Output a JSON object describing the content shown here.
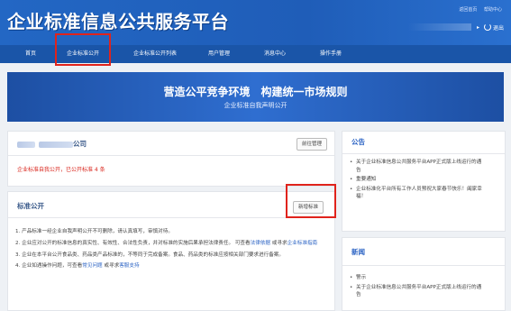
{
  "app": {
    "logo_text": "企业标准信息公共服务平台"
  },
  "top_links": {
    "back_home": "返回首页",
    "help_center": "帮助中心"
  },
  "user": {
    "logout": "退出"
  },
  "nav": {
    "items": [
      "首页",
      "企业标准公开",
      "企业标准公开列表",
      "用户管理",
      "消息中心",
      "操作手册"
    ],
    "highlighted": "企业标准公开"
  },
  "banner": {
    "headline": "营造公平竞争环境　构建统一市场规则",
    "subtitle": "企业标准自我声明公开"
  },
  "company_card": {
    "name_suffix": "公司",
    "manage_button": "前往管理",
    "status_text": "企业标准自我公开，已公开标准 4 条"
  },
  "std_card": {
    "title": "标准公开",
    "add_button": "新增标准",
    "rules": [
      {
        "text": "1. 产品标准一经企业自我声明公开不可删除，请认真填写，审慎对待。"
      },
      {
        "text": "2. 企业应对公开的标准信息的真实性、有效性、合法性负责，并对标准的实施后果承担法律责任。 可查看",
        "link1": "法律依据",
        "mid": " 或寻求",
        "link2": "企业标准指南"
      },
      {
        "text": "3. 企业在本平台公开食品类、药品类产品标准的，不等同于完成备案。食品、药品类的标准应按相关部门要求进行备案。"
      },
      {
        "text": "4. 企业如遇操作问题，可查看",
        "link1": "常见问题",
        "mid": " 或寻求",
        "link2": "客服支持"
      }
    ]
  },
  "announcements": {
    "title": "公告",
    "items": [
      "关于企业标准信息公共服务平台APP正式版上线运行的通告",
      "重要通知",
      "企业标准化平台所有工作人员预祝大家春节快乐！阖家幸福！"
    ]
  },
  "news": {
    "title": "新闻",
    "items": [
      "警示",
      "关于企业标准信息公共服务平台APP正式版上线运行的通告"
    ]
  },
  "colors": {
    "primary": "#1f5db8",
    "nav": "#1a55a8",
    "highlight_box": "#e0231c",
    "status_red": "#d9241b",
    "link": "#2b63c4"
  }
}
